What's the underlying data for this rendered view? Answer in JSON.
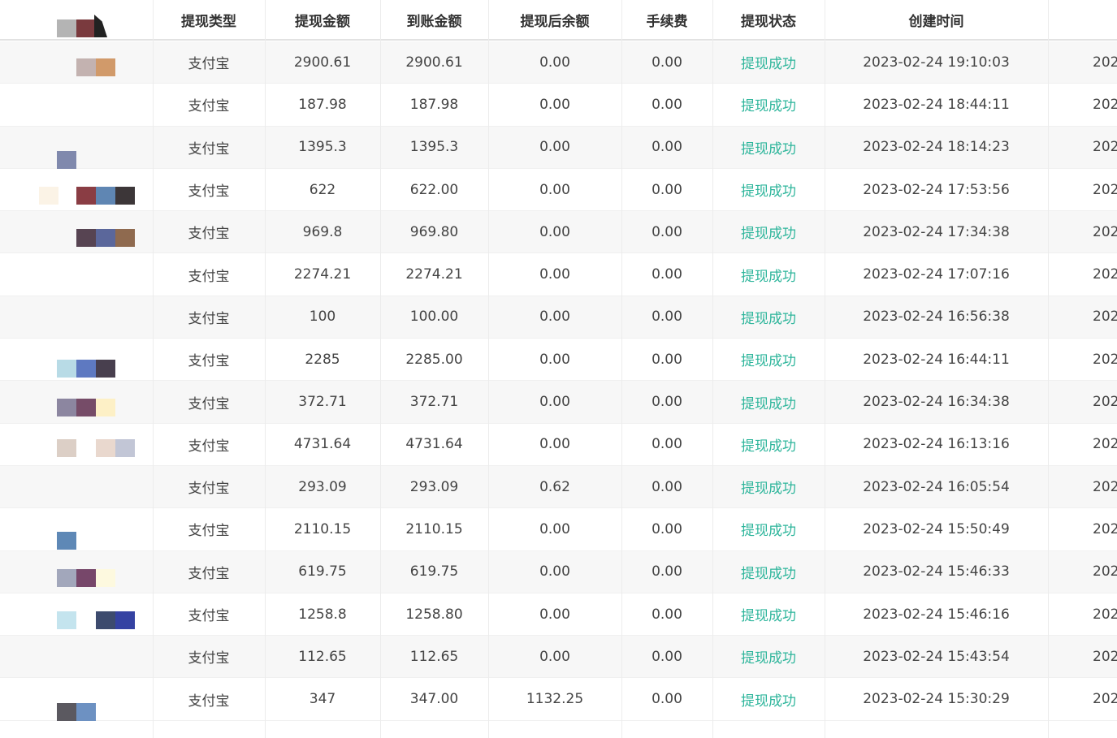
{
  "table": {
    "headers": [
      "提现类型",
      "提现金额",
      "到账金额",
      "提现后余额",
      "手续费",
      "提现状态",
      "创建时间"
    ],
    "rows": [
      {
        "type": "支付宝",
        "amount": "2900.61",
        "received": "2900.61",
        "balance": "0.00",
        "fee": "0.00",
        "status": "提现成功",
        "created": "2023-02-24 19:10:03",
        "trail": "202"
      },
      {
        "type": "支付宝",
        "amount": "187.98",
        "received": "187.98",
        "balance": "0.00",
        "fee": "0.00",
        "status": "提现成功",
        "created": "2023-02-24 18:44:11",
        "trail": "202"
      },
      {
        "type": "支付宝",
        "amount": "1395.3",
        "received": "1395.3",
        "balance": "0.00",
        "fee": "0.00",
        "status": "提现成功",
        "created": "2023-02-24 18:14:23",
        "trail": "202"
      },
      {
        "type": "支付宝",
        "amount": "622",
        "received": "622.00",
        "balance": "0.00",
        "fee": "0.00",
        "status": "提现成功",
        "created": "2023-02-24 17:53:56",
        "trail": "202"
      },
      {
        "type": "支付宝",
        "amount": "969.8",
        "received": "969.80",
        "balance": "0.00",
        "fee": "0.00",
        "status": "提现成功",
        "created": "2023-02-24 17:34:38",
        "trail": "202"
      },
      {
        "type": "支付宝",
        "amount": "2274.21",
        "received": "2274.21",
        "balance": "0.00",
        "fee": "0.00",
        "status": "提现成功",
        "created": "2023-02-24 17:07:16",
        "trail": "202"
      },
      {
        "type": "支付宝",
        "amount": "100",
        "received": "100.00",
        "balance": "0.00",
        "fee": "0.00",
        "status": "提现成功",
        "created": "2023-02-24 16:56:38",
        "trail": "202"
      },
      {
        "type": "支付宝",
        "amount": "2285",
        "received": "2285.00",
        "balance": "0.00",
        "fee": "0.00",
        "status": "提现成功",
        "created": "2023-02-24 16:44:11",
        "trail": "202"
      },
      {
        "type": "支付宝",
        "amount": "372.71",
        "received": "372.71",
        "balance": "0.00",
        "fee": "0.00",
        "status": "提现成功",
        "created": "2023-02-24 16:34:38",
        "trail": "202"
      },
      {
        "type": "支付宝",
        "amount": "4731.64",
        "received": "4731.64",
        "balance": "0.00",
        "fee": "0.00",
        "status": "提现成功",
        "created": "2023-02-24 16:13:16",
        "trail": "202"
      },
      {
        "type": "支付宝",
        "amount": "293.09",
        "received": "293.09",
        "balance": "0.62",
        "fee": "0.00",
        "status": "提现成功",
        "created": "2023-02-24 16:05:54",
        "trail": "202"
      },
      {
        "type": "支付宝",
        "amount": "2110.15",
        "received": "2110.15",
        "balance": "0.00",
        "fee": "0.00",
        "status": "提现成功",
        "created": "2023-02-24 15:50:49",
        "trail": "202"
      },
      {
        "type": "支付宝",
        "amount": "619.75",
        "received": "619.75",
        "balance": "0.00",
        "fee": "0.00",
        "status": "提现成功",
        "created": "2023-02-24 15:46:33",
        "trail": "202"
      },
      {
        "type": "支付宝",
        "amount": "1258.8",
        "received": "1258.80",
        "balance": "0.00",
        "fee": "0.00",
        "status": "提现成功",
        "created": "2023-02-24 15:46:16",
        "trail": "202"
      },
      {
        "type": "支付宝",
        "amount": "112.65",
        "received": "112.65",
        "balance": "0.00",
        "fee": "0.00",
        "status": "提现成功",
        "created": "2023-02-24 15:43:54",
        "trail": "202"
      },
      {
        "type": "支付宝",
        "amount": "347",
        "received": "347.00",
        "balance": "1132.25",
        "fee": "0.00",
        "status": "提现成功",
        "created": "2023-02-24 15:30:29",
        "trail": "202"
      }
    ]
  },
  "colors": {
    "status_success": "#2db59b",
    "row_stripe": "#f7f7f7",
    "header_border": "#e2e2e2"
  }
}
